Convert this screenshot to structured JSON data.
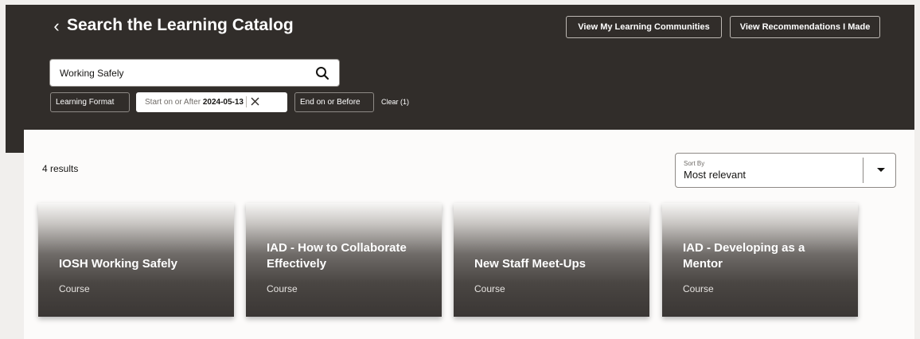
{
  "header": {
    "title": "Search the Learning Catalog",
    "buttons": {
      "communities": "View My Learning Communities",
      "recommendations": "View Recommendations I Made"
    }
  },
  "search": {
    "value": "Working Safely"
  },
  "filters": {
    "learning_format": "Learning Format",
    "start_label": "Start on or After",
    "start_date": "2024-05-13",
    "end_label": "End on or Before",
    "clear_all": "Clear (1)"
  },
  "results": {
    "count_text": "4 results"
  },
  "sort": {
    "label": "Sort By",
    "value": "Most relevant"
  },
  "cards": [
    {
      "title": "IOSH Working Safely",
      "type": "Course"
    },
    {
      "title": "IAD - How to Collaborate Effectively",
      "type": "Course"
    },
    {
      "title": "New Staff Meet-Ups",
      "type": "Course"
    },
    {
      "title": "IAD - Developing as a Mentor",
      "type": "Course"
    }
  ],
  "icons": {
    "back": "chevron-left-icon",
    "search": "search-icon",
    "clear_filter": "close-icon",
    "sort": "caret-down-icon"
  },
  "colors": {
    "header_bg": "#312d2a",
    "page_bg": "#f1efed",
    "panel_bg": "#fcfbfa"
  }
}
